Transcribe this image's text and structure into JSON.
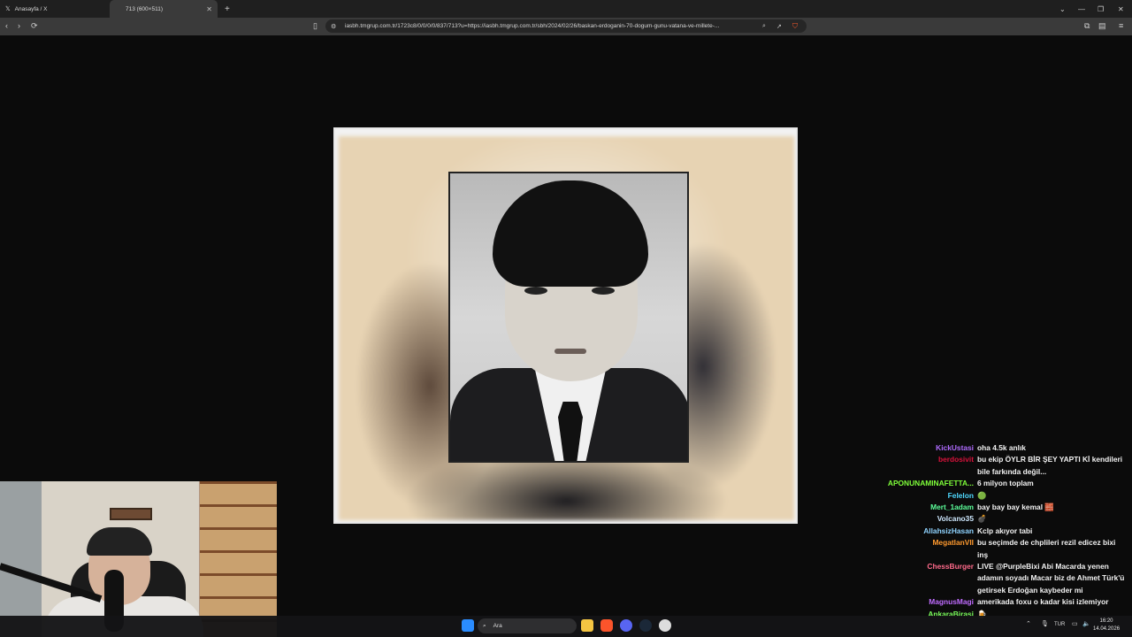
{
  "browser": {
    "tabs": [
      {
        "title": "Anasayfa / X",
        "icon": "x-logo-icon"
      },
      {
        "title": "713 (600×511)",
        "icon": "image-icon"
      }
    ],
    "url": "iasbh.tmgrup.com.tr/1723c8/0/0/0/0/837/713?u=https://iasbh.tmgrup.com.tr/sbh/2024/02/26/baskan-erdoganin-70-dogum-gunu-vatana-ve-millete-..."
  },
  "chat": [
    {
      "user": "KickUstasi",
      "color": "#b06cff",
      "text": "oha 4.5k anlık"
    },
    {
      "user": "berdosivit",
      "color": "#d8123b",
      "text": "bu ekip ÖYLR BİR ŞEY YAPTI Kİ kendileri bile farkında değil..."
    },
    {
      "user": "APONUNAMINAFETTA...",
      "color": "#7fff3a",
      "text": "6 milyon toplam"
    },
    {
      "user": "Felelon",
      "color": "#4fd9ff",
      "text": "🟢"
    },
    {
      "user": "Mert_1adam",
      "color": "#5cff9a",
      "text": "bay bay bay kemal 🧱"
    },
    {
      "user": "Volcano35",
      "color": "#cfe9ff",
      "text": "💣"
    },
    {
      "user": "AllahsizHasan",
      "color": "#8fd3ff",
      "text": "Kclp akıyor tabi"
    },
    {
      "user": "MegatlanVII",
      "color": "#ff9a2e",
      "text": "bu seçimde de chplileri rezil edicez bixi inş"
    },
    {
      "user": "ChessBurger",
      "color": "#ff6a8a",
      "text": "LIVE @PurpleBixi Abi Macarda yenen adamın soyadı Macar biz de Ahmet Türk'ü getirsek Erdoğan kaybeder mi"
    },
    {
      "user": "MagnusMagi",
      "color": "#c06cff",
      "text": "amerikada foxu o kadar kisi izlemiyor"
    },
    {
      "user": "AnkaraBirasi",
      "color": "#7bff5c",
      "text": "🍺"
    }
  ],
  "taskbar": {
    "search_placeholder": "Ara",
    "lang": "TUR",
    "time": "16:20",
    "date": "14.04.2026"
  }
}
